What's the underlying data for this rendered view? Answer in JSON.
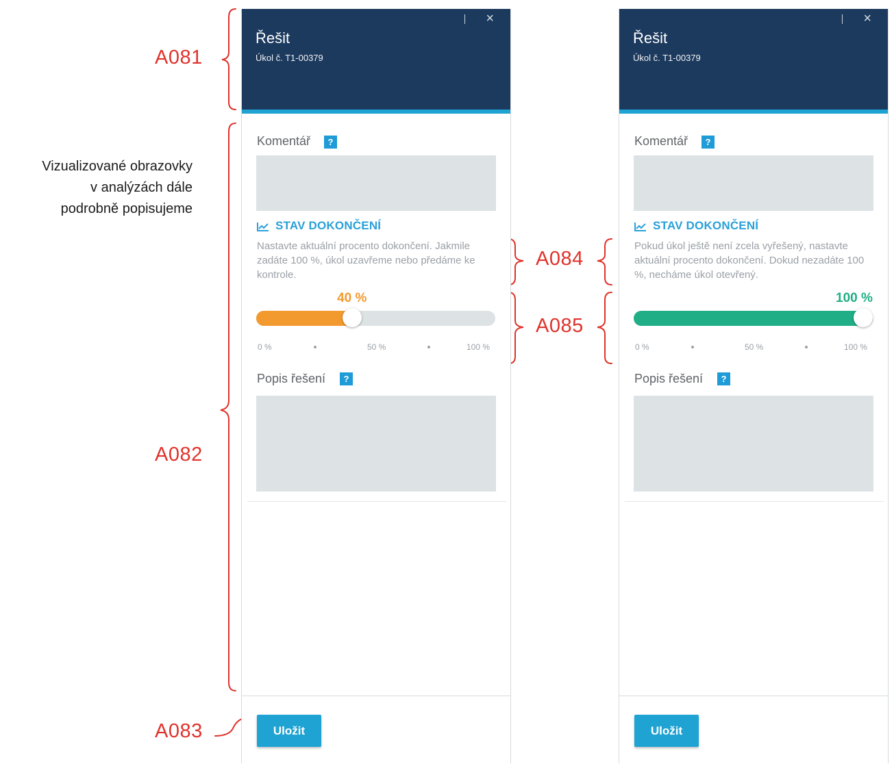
{
  "annotations": {
    "a081": "A081",
    "a082": "A082",
    "a083": "A083",
    "a084": "A084",
    "a085": "A085",
    "side_note": [
      "Vizualizované obrazovky",
      "v analýzách dále",
      "podrobně popisujeme"
    ],
    "color": "#e0322b"
  },
  "panels": [
    {
      "title": "Řešit",
      "subtitle": "Úkol č. T1-00379",
      "close_icon": "close-icon",
      "comment_label": "Komentář",
      "help_icon": "?",
      "section_title": "STAV DOKONČENÍ",
      "section_icon": "chart-line-icon",
      "description": "Nastavte aktuální procento dokončení. Jakmile zadáte 100 %, úkol uzavřeme nebo předáme ke kontrole.",
      "progress_label": "40 %",
      "progress_value": 40,
      "progress_color": "#f39a2e",
      "ticks": [
        "0 %",
        "50 %",
        "100 %"
      ],
      "solution_label": "Popis řešení",
      "save_label": "Uložit"
    },
    {
      "title": "Řešit",
      "subtitle": "Úkol č. T1-00379",
      "close_icon": "close-icon",
      "comment_label": "Komentář",
      "help_icon": "?",
      "section_title": "STAV DOKONČENÍ",
      "section_icon": "chart-line-icon",
      "description": "Pokud úkol ještě není zcela vyřešený, nastavte aktuální procento dokončení. Dokud nezadáte 100 %, necháme úkol otevřený.",
      "progress_label": "100 %",
      "progress_value": 100,
      "progress_color": "#1fae85",
      "ticks": [
        "0 %",
        "50 %",
        "100 %"
      ],
      "solution_label": "Popis řešení",
      "save_label": "Uložit"
    }
  ],
  "colors": {
    "header_bg": "#1c3a5e",
    "header_accent": "#1fa3d2",
    "button_bg": "#1fa3d2",
    "field_bg": "#dde2e5",
    "section_title": "#2aa0d8"
  }
}
